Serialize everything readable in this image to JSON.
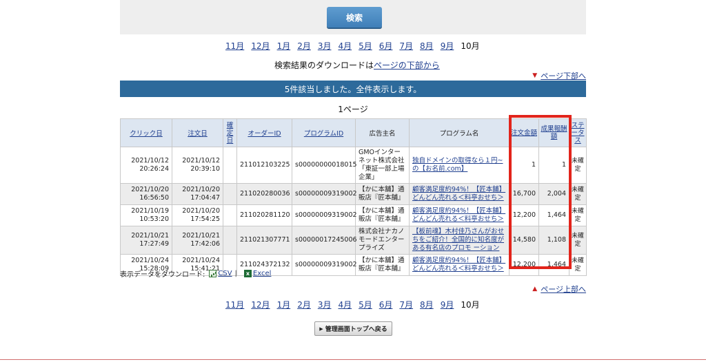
{
  "search": {
    "button_label": "検索"
  },
  "month_nav": {
    "links": [
      "11月",
      "12月",
      "1月",
      "2月",
      "3月",
      "4月",
      "5月",
      "6月",
      "7月",
      "8月",
      "9月"
    ],
    "current": "10月"
  },
  "download_note": {
    "prefix": "検索結果のダウンロードは",
    "link": "ページの下部から"
  },
  "page_down_label": "ページ下部へ",
  "page_up_label": "ページ上部へ",
  "result_message": "5件該当しました。全件表示します。",
  "page_label": "1ページ",
  "table": {
    "headers": {
      "click_date": "クリック日",
      "order_date": "注文日",
      "confirm_date": "確定日",
      "order_id": "オーダーID",
      "program_id": "プログラムID",
      "advertiser": "広告主名",
      "program_name": "プログラム名",
      "order_amount": "注文金額",
      "reward": "成果報酬額",
      "status": "ステータス"
    },
    "rows": [
      {
        "click_date": "2021/10/12\n20:26:24",
        "order_date": "2021/10/12\n20:39:10",
        "confirm_date": "",
        "order_id": "211012103225",
        "program_id": "s00000000018015",
        "advertiser": "GMOインターネット株式会社「東証一部上場企業」",
        "program_name": "独自ドメインの取得なら１円~の【お名前.com】",
        "order_amount": "1",
        "reward": "1",
        "status": "未確定"
      },
      {
        "click_date": "2021/10/20\n16:56:50",
        "order_date": "2021/10/20\n17:04:47",
        "confirm_date": "",
        "order_id": "211020280036",
        "program_id": "s00000009319002",
        "advertiser": "【かに本舗】通販店『匠本舗』",
        "program_name": "顧客満足度約94%！【匠本舗】どんどん売れる＜料亭おせち＞",
        "order_amount": "16,700",
        "reward": "2,004",
        "status": "未確定"
      },
      {
        "click_date": "2021/10/19\n10:53:20",
        "order_date": "2021/10/20\n17:54:25",
        "confirm_date": "",
        "order_id": "211020281120",
        "program_id": "s00000009319002",
        "advertiser": "【かに本舗】通販店『匠本舗』",
        "program_name": "顧客満足度約94%！【匠本舗】どんどん売れる＜料亭おせち＞",
        "order_amount": "12,200",
        "reward": "1,464",
        "status": "未確定"
      },
      {
        "click_date": "2021/10/21\n17:27:49",
        "order_date": "2021/10/21\n17:42:06",
        "confirm_date": "",
        "order_id": "211021307771",
        "program_id": "s00000017245006",
        "advertiser": "株式会社ナカノモードエンタープライズ",
        "program_name": "【板前魂】木村佳乃さんがおせちをご紹介！全国的に知名度がある有名店のプロモ ーション",
        "order_amount": "14,580",
        "reward": "1,108",
        "status": "未確定"
      },
      {
        "click_date": "2021/10/24\n15:28:09",
        "order_date": "2021/10/24\n15:41:21",
        "confirm_date": "",
        "order_id": "211024372132",
        "program_id": "s00000009319002",
        "advertiser": "【かに本舗】通販店『匠本舗』",
        "program_name": "顧客満足度約94%！【匠本舗】どんどん売れる＜料亭おせち＞",
        "order_amount": "12,200",
        "reward": "1,464",
        "status": "未確定"
      }
    ]
  },
  "export": {
    "label": "表示データをダウンロード:",
    "csv": "CSV",
    "separator": "|",
    "excel": "Excel"
  },
  "back_button_label": "管理画面トップへ戻る",
  "colors": {
    "result_bar": "#2d6a9b",
    "header_bg": "#dde6f1",
    "highlight": "#e2241b",
    "link": "#1f3f8f"
  },
  "icons": {
    "csv": "csv-file-icon",
    "excel": "excel-icon",
    "page_down": "triangle-down-icon",
    "page_up": "triangle-up-icon"
  }
}
